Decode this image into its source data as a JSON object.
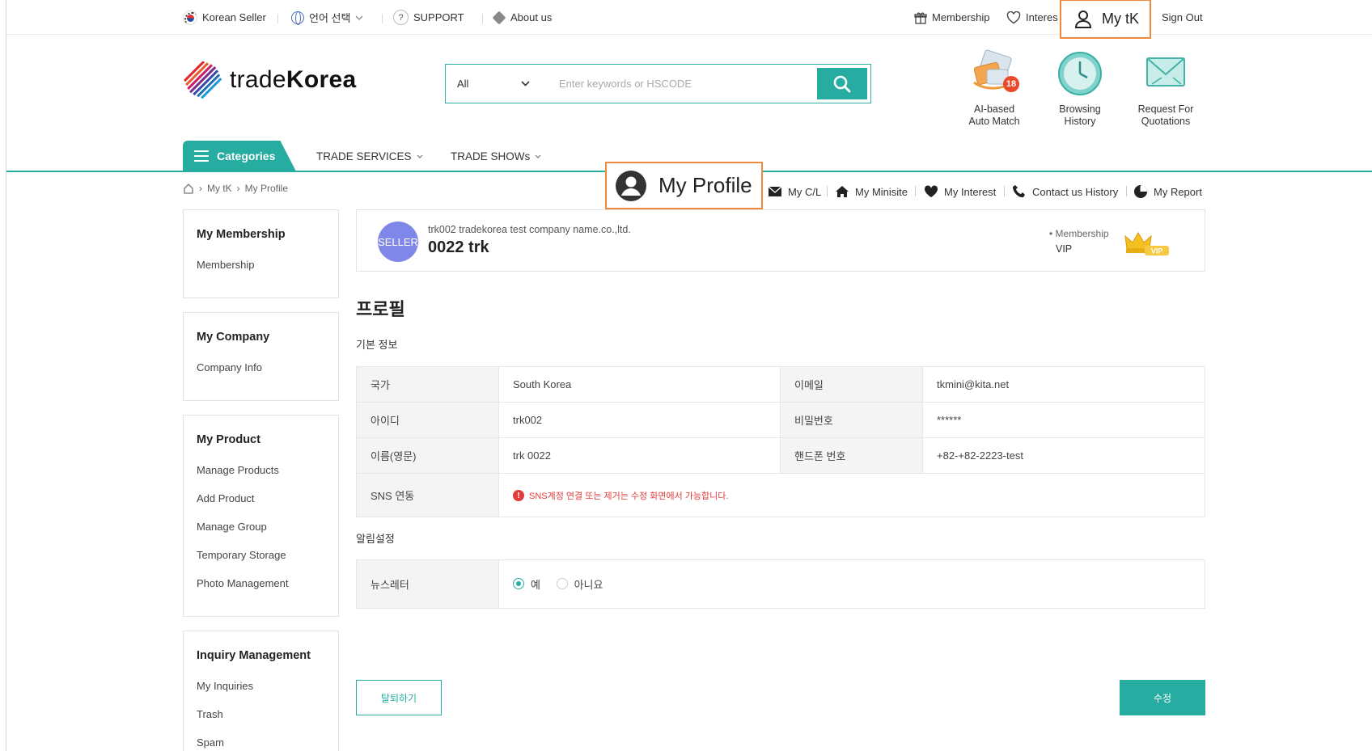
{
  "topbar": {
    "korean_seller": "Korean Seller",
    "language": "언어 선택",
    "support": "SUPPORT",
    "about": "About us",
    "membership": "Membership",
    "interest": "Interes",
    "mytk": "My tK",
    "signout": "Sign Out"
  },
  "logo": {
    "light": "trade",
    "bold": "Korea"
  },
  "search": {
    "category": "All",
    "placeholder": "Enter keywords or HSCODE"
  },
  "quick_links": [
    {
      "label_line1": "AI-based",
      "label_line2": "Auto Match",
      "badge": "18"
    },
    {
      "label_line1": "Browsing",
      "label_line2": "History"
    },
    {
      "label_line1": "Request For",
      "label_line2": "Quotations"
    }
  ],
  "nav": {
    "categories": "Categories",
    "trade_services": "TRADE SERVICES",
    "trade_shows": "TRADE SHOWs"
  },
  "breadcrumb": {
    "level1": "My tK",
    "level2": "My Profile"
  },
  "subnav": {
    "my_profile": "My Profile",
    "my_cl": "My C/L",
    "my_minisite": "My Minisite",
    "my_interest": "My Interest",
    "contact_history": "Contact us History",
    "my_report": "My Report"
  },
  "sidebar": [
    {
      "title": "My Membership",
      "items": [
        "Membership"
      ]
    },
    {
      "title": "My Company",
      "items": [
        "Company Info"
      ]
    },
    {
      "title": "My Product",
      "items": [
        "Manage Products",
        "Add Product",
        "Manage Group",
        "Temporary Storage",
        "Photo Management"
      ]
    },
    {
      "title": "Inquiry Management",
      "items": [
        "My Inquiries",
        "Trash",
        "Spam"
      ]
    }
  ],
  "profile_card": {
    "badge": "SELLER",
    "company": "trk002 tradekorea test company name.co.,ltd.",
    "name": "0022 trk",
    "membership_label": "• Membership",
    "membership_value": "VIP",
    "crown_text": "VIP"
  },
  "page": {
    "title": "프로필",
    "basic_info": "기본 정보",
    "alarm_settings": "알림설정"
  },
  "basic_info": {
    "country_label": "국가",
    "country_value": "South Korea",
    "email_label": "이메일",
    "email_value": "tkmini@kita.net",
    "id_label": "아이디",
    "id_value": "trk002",
    "password_label": "비밀번호",
    "password_value": "******",
    "name_label": "이름(영문)",
    "name_value": "trk 0022",
    "phone_label": "핸드폰 번호",
    "phone_value": "+82-+82-2223-test",
    "sns_label": "SNS 연동",
    "sns_notice": "SNS계정 연결 또는 제거는 수정 화면에서 가능합니다."
  },
  "alarm": {
    "newsletter_label": "뉴스레터",
    "yes": "예",
    "no": "아니요",
    "selected": "yes"
  },
  "buttons": {
    "withdraw": "탈퇴하기",
    "edit": "수정"
  },
  "colors": {
    "accent": "#26aca0",
    "highlight": "#f08a3c",
    "seller_badge": "#7f88e8",
    "warning": "#e03c3c"
  }
}
